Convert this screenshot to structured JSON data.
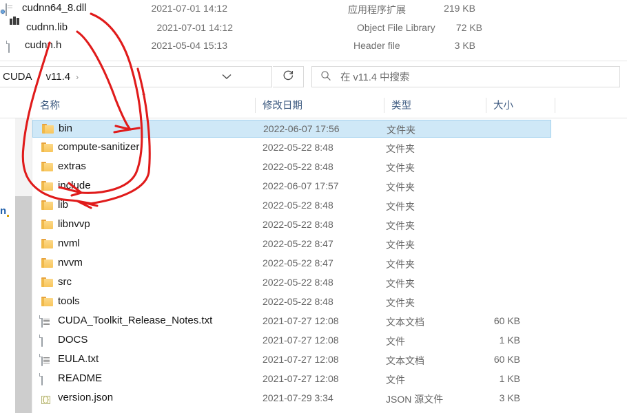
{
  "top_fragment": {
    "rows": [
      {
        "icon": "dll-file-icon",
        "name": "cudnn64_8.dll",
        "date": "2021-07-01 14:12",
        "type": "应用程序扩展",
        "size": "219 KB"
      },
      {
        "icon": "lib-file-icon",
        "name": "cudnn.lib",
        "date": "2021-07-01 14:12",
        "type": "Object File Library",
        "size": "72 KB"
      },
      {
        "icon": "header-file-icon",
        "name": "cudnn.h",
        "date": "2021-05-04 15:13",
        "type": "Header file",
        "size": "3 KB"
      }
    ]
  },
  "address_bar": {
    "breadcrumbs": [
      "CUDA",
      "v11.4"
    ],
    "separator": "›",
    "trailing_separator": "›",
    "dropdown_icon": "chevron-down-icon",
    "refresh_icon": "refresh-icon",
    "search": {
      "icon": "search-icon",
      "placeholder": "在 v11.4 中搜索"
    }
  },
  "nav_rail": {
    "forward_icon": "right-arrow-icon",
    "collapse_icon": "chevron-up-icon",
    "left_fragment_text": "n"
  },
  "columns": {
    "name": "名称",
    "date_modified": "修改日期",
    "type": "类型",
    "size": "大小",
    "sort_indicator": "caret-up-icon"
  },
  "files": [
    {
      "icon": "folder-icon",
      "name": "bin",
      "date": "2022-06-07 17:56",
      "type": "文件夹",
      "size": "",
      "selected": true
    },
    {
      "icon": "folder-icon",
      "name": "compute-sanitizer",
      "date": "2022-05-22 8:48",
      "type": "文件夹",
      "size": "",
      "selected": false
    },
    {
      "icon": "folder-icon",
      "name": "extras",
      "date": "2022-05-22 8:48",
      "type": "文件夹",
      "size": "",
      "selected": false
    },
    {
      "icon": "folder-icon",
      "name": "include",
      "date": "2022-06-07 17:57",
      "type": "文件夹",
      "size": "",
      "selected": false
    },
    {
      "icon": "folder-icon",
      "name": "lib",
      "date": "2022-05-22 8:48",
      "type": "文件夹",
      "size": "",
      "selected": false
    },
    {
      "icon": "folder-icon",
      "name": "libnvvp",
      "date": "2022-05-22 8:48",
      "type": "文件夹",
      "size": "",
      "selected": false
    },
    {
      "icon": "folder-icon",
      "name": "nvml",
      "date": "2022-05-22 8:47",
      "type": "文件夹",
      "size": "",
      "selected": false
    },
    {
      "icon": "folder-icon",
      "name": "nvvm",
      "date": "2022-05-22 8:47",
      "type": "文件夹",
      "size": "",
      "selected": false
    },
    {
      "icon": "folder-icon",
      "name": "src",
      "date": "2022-05-22 8:48",
      "type": "文件夹",
      "size": "",
      "selected": false
    },
    {
      "icon": "folder-icon",
      "name": "tools",
      "date": "2022-05-22 8:48",
      "type": "文件夹",
      "size": "",
      "selected": false
    },
    {
      "icon": "text-file-icon",
      "name": "CUDA_Toolkit_Release_Notes.txt",
      "date": "2021-07-27 12:08",
      "type": "文本文档",
      "size": "60 KB",
      "selected": false
    },
    {
      "icon": "plain-file-icon",
      "name": "DOCS",
      "date": "2021-07-27 12:08",
      "type": "文件",
      "size": "1 KB",
      "selected": false
    },
    {
      "icon": "text-file-icon",
      "name": "EULA.txt",
      "date": "2021-07-27 12:08",
      "type": "文本文档",
      "size": "60 KB",
      "selected": false
    },
    {
      "icon": "plain-file-icon",
      "name": "README",
      "date": "2021-07-27 12:08",
      "type": "文件",
      "size": "1 KB",
      "selected": false
    },
    {
      "icon": "json-file-icon",
      "name": "version.json",
      "date": "2021-07-29 3:34",
      "type": "JSON 源文件",
      "size": "3 KB",
      "selected": false
    }
  ],
  "annotations": {
    "color": "#e01b1b",
    "arrows": [
      {
        "name": "arrow-to-bin",
        "from": "cudnn.lib",
        "to": "bin"
      },
      {
        "name": "arrow-to-include",
        "from": "cudnn64_8.dll",
        "to": "include"
      },
      {
        "name": "arrow-to-lib",
        "from": "cudnn.h",
        "to": "lib"
      }
    ]
  },
  "colors": {
    "selection": "#cfe8f7",
    "selection_border": "#a5d2ef",
    "header_text": "#3d5a80",
    "folder": "#f8c65c",
    "annotation_red": "#e01b1b"
  }
}
